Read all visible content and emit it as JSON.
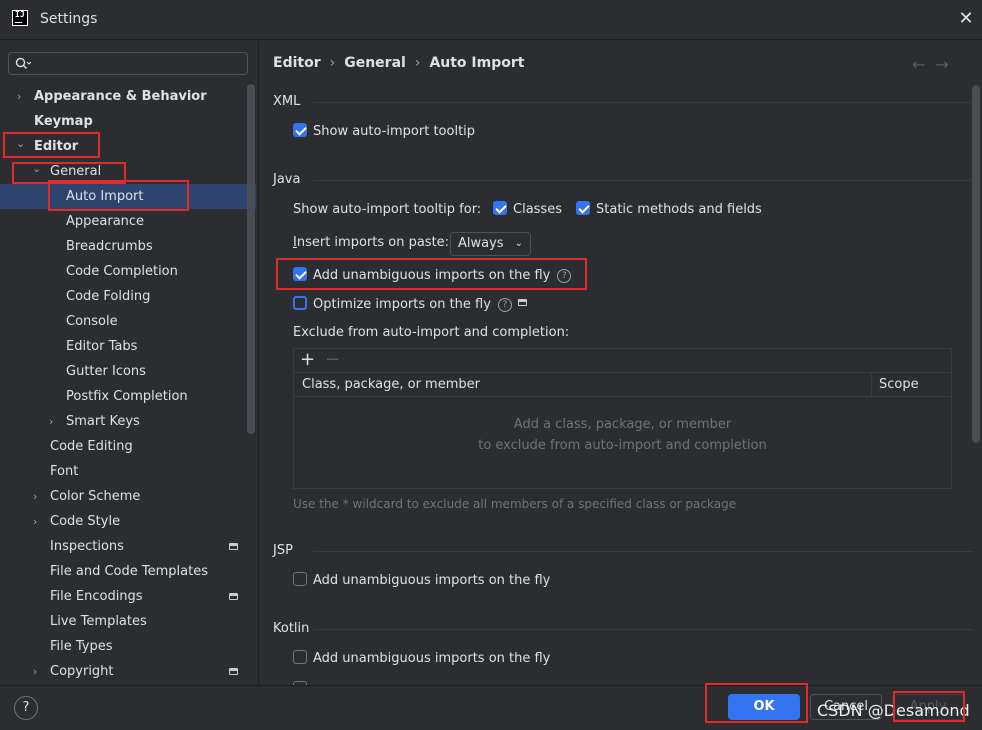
{
  "window": {
    "title": "Settings"
  },
  "sidebar": {
    "items": [
      {
        "label": "Appearance & Behavior",
        "chevron": "›"
      },
      {
        "label": "Keymap"
      },
      {
        "label": "Editor",
        "chevron": "⌄"
      },
      {
        "label": "General",
        "chevron": "⌄"
      },
      {
        "label": "Auto Import"
      },
      {
        "label": "Appearance"
      },
      {
        "label": "Breadcrumbs"
      },
      {
        "label": "Code Completion"
      },
      {
        "label": "Code Folding"
      },
      {
        "label": "Console"
      },
      {
        "label": "Editor Tabs"
      },
      {
        "label": "Gutter Icons"
      },
      {
        "label": "Postfix Completion"
      },
      {
        "label": "Smart Keys",
        "chevron": "›"
      },
      {
        "label": "Code Editing"
      },
      {
        "label": "Font"
      },
      {
        "label": "Color Scheme",
        "chevron": "›"
      },
      {
        "label": "Code Style",
        "chevron": "›"
      },
      {
        "label": "Inspections"
      },
      {
        "label": "File and Code Templates"
      },
      {
        "label": "File Encodings"
      },
      {
        "label": "Live Templates"
      },
      {
        "label": "File Types"
      },
      {
        "label": "Copyright",
        "chevron": "›"
      }
    ]
  },
  "breadcrumb": {
    "part1": "Editor",
    "part2": "General",
    "part3": "Auto Import",
    "sep": "›"
  },
  "nav": {
    "back": "←",
    "forward": "→"
  },
  "xml": {
    "section": "XML",
    "show_tooltip": "Show auto-import tooltip"
  },
  "java": {
    "section": "Java",
    "tooltip_for": "Show auto-import tooltip for:",
    "classes": "Classes",
    "static_methods": "Static methods and fields",
    "insert_on_paste": "Insert imports on paste:",
    "insert_on_paste_mnemonic": "I",
    "insert_on_paste_rest": "nsert imports on paste:",
    "paste_option": "Always",
    "add_unambiguous": "Add unambiguous imports on the fly",
    "optimize": "Optimize imports on the fly",
    "exclude_label": "Exclude from auto-import and completion:",
    "table": {
      "col_member": "Class, package, or member",
      "col_scope": "Scope",
      "empty_line1": "Add a class, package, or member",
      "empty_line2": "to exclude from auto-import and completion"
    },
    "wildcard_hint": "Use the * wildcard to exclude all members of a specified class or package"
  },
  "jsp": {
    "section": "JSP",
    "add_unambiguous": "Add unambiguous imports on the fly"
  },
  "kotlin": {
    "section": "Kotlin",
    "add_unambiguous": "Add unambiguous imports on the fly"
  },
  "footer": {
    "help": "?",
    "ok": "OK",
    "cancel": "Cancel",
    "apply": "Apply",
    "watermark": "CSDN @Desamond"
  },
  "colors": {
    "accent": "#3574f0",
    "annotation": "#e02b2b",
    "selection": "#2e436e"
  }
}
